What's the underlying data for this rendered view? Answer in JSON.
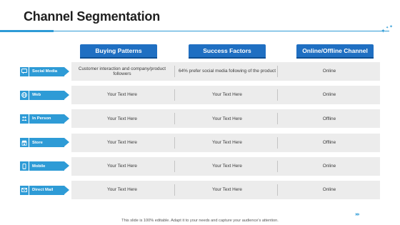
{
  "title": "Channel Segmentation",
  "columns": [
    "Buying Patterns",
    "Success Factors",
    "Online/Offline Channel"
  ],
  "rows": [
    {
      "label": "Social Media",
      "icon": "social-media-icon",
      "cells": [
        "Customer interaction and company/product followers",
        "64% prefer social media following of the product",
        "Online"
      ]
    },
    {
      "label": "Web",
      "icon": "globe-icon",
      "cells": [
        "Your Text Here",
        "Your Text Here",
        "Online"
      ]
    },
    {
      "label": "In Person",
      "icon": "people-icon",
      "cells": [
        "Your Text Here",
        "Your Text Here",
        "Offline"
      ]
    },
    {
      "label": "Store",
      "icon": "store-icon",
      "cells": [
        "Your Text Here",
        "Your Text Here",
        "Offline"
      ]
    },
    {
      "label": "Mobile",
      "icon": "mobile-icon",
      "cells": [
        "Your Text Here",
        "Your Text Here",
        "Online"
      ]
    },
    {
      "label": "Direct Mail",
      "icon": "mail-icon",
      "cells": [
        "Your Text Here",
        "Your Text Here",
        "Online"
      ]
    }
  ],
  "footer": "This slide is 100% editable. Adapt it to your needs and capture your audience's attention.",
  "next_arrows": "››››",
  "colors": {
    "accent": "#2e9bd6",
    "header": "#1f6fc2",
    "row_bg": "#ececec"
  }
}
